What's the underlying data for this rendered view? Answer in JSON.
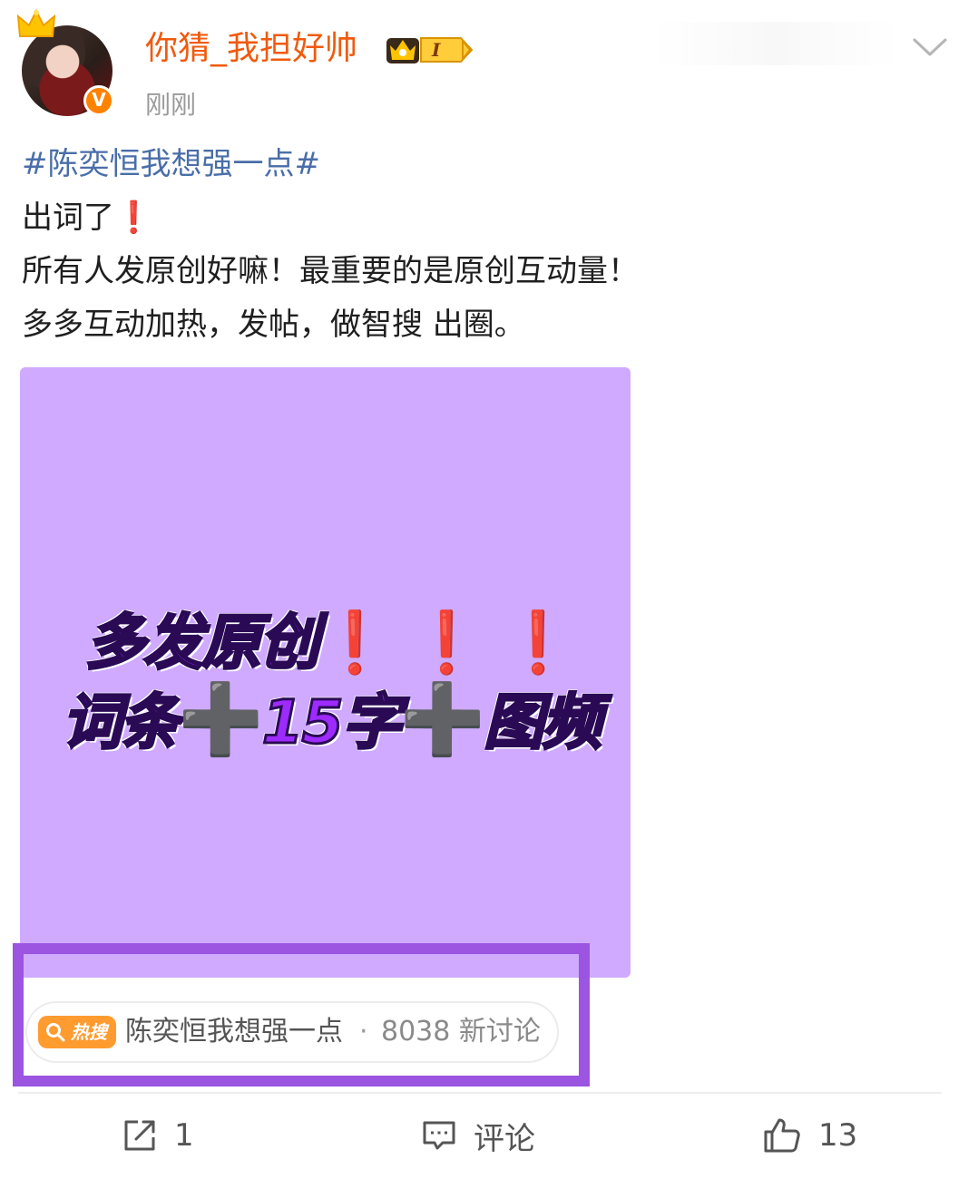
{
  "post": {
    "author": {
      "name": "你猜_我担好帅",
      "vip_level": "I",
      "timestamp": "刚刚",
      "verified_mark": "V"
    },
    "hashtag": "#陈奕恒我想强一点#",
    "lines": [
      "出词了",
      "所有人发原创好嘛！最重要的是原创互动量！",
      "多多互动加热，发帖，做智搜 出圈。"
    ],
    "emoji_exclaim": "❗",
    "image": {
      "line1": "多发原创",
      "line1_marks": "❗ ❗ ❗",
      "line2_a": "词条",
      "line2_b": "15字",
      "line2_c": "图频",
      "plus": "➕",
      "background_color": "#cfaaff"
    },
    "hot_search": {
      "badge_label": "热搜",
      "topic": "陈奕恒我想强一点",
      "separator": "·",
      "count_text": "8038 新讨论",
      "highlight_color": "#9b55e0"
    },
    "actions": {
      "repost_count": "1",
      "comment_label": "评论",
      "like_count": "13"
    }
  },
  "colors": {
    "username": "#f05a0e",
    "hashtag": "#4a6ea8",
    "verified": "#ff8200",
    "hot_badge": "#ff9b2f"
  },
  "icons": [
    "crown-icon",
    "verified-icon",
    "vip-badge-icon",
    "chevron-down-icon",
    "search-icon",
    "repost-icon",
    "comment-icon",
    "like-icon"
  ]
}
